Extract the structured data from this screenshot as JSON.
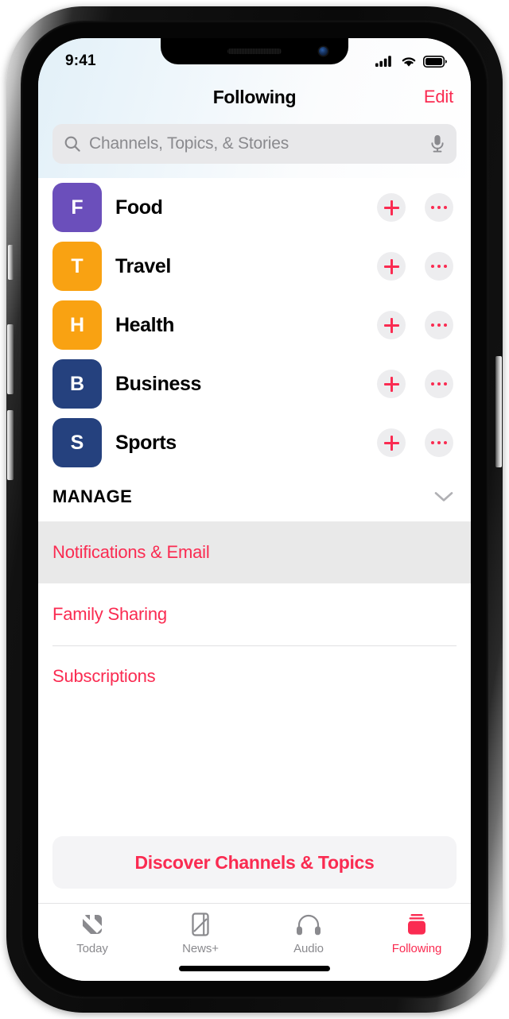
{
  "device": {
    "status_bar": {
      "time": "9:41",
      "cellular_icon": "signal-bars-icon",
      "wifi_icon": "wifi-icon",
      "battery_icon": "battery-full-icon"
    },
    "home_indicator": "home-indicator"
  },
  "nav": {
    "title": "Following",
    "edit_label": "Edit"
  },
  "search": {
    "placeholder": "Channels, Topics, & Stories",
    "value": "",
    "search_icon": "search-icon",
    "mic_icon": "microphone-icon"
  },
  "channels": [
    {
      "letter": "F",
      "name": "Food",
      "color": "#6B4FBB",
      "add_icon": "plus-icon",
      "more_icon": "ellipsis-icon"
    },
    {
      "letter": "T",
      "name": "Travel",
      "color": "#F9A212",
      "add_icon": "plus-icon",
      "more_icon": "ellipsis-icon"
    },
    {
      "letter": "H",
      "name": "Health",
      "color": "#F9A212",
      "add_icon": "plus-icon",
      "more_icon": "ellipsis-icon"
    },
    {
      "letter": "B",
      "name": "Business",
      "color": "#25417E",
      "add_icon": "plus-icon",
      "more_icon": "ellipsis-icon"
    },
    {
      "letter": "S",
      "name": "Sports",
      "color": "#25417E",
      "add_icon": "plus-icon",
      "more_icon": "ellipsis-icon"
    }
  ],
  "manage": {
    "header": "MANAGE",
    "collapse_icon": "chevron-down-icon",
    "items": [
      {
        "label": "Notifications & Email",
        "highlighted": true,
        "divider_above": false
      },
      {
        "label": "Family Sharing",
        "highlighted": false,
        "divider_above": false
      },
      {
        "label": "Subscriptions",
        "highlighted": false,
        "divider_above": true
      }
    ]
  },
  "discover": {
    "label": "Discover Channels & Topics"
  },
  "tabs": [
    {
      "label": "Today",
      "icon": "apple-news-n-icon",
      "active": false
    },
    {
      "label": "News+",
      "icon": "magazine-icon",
      "active": false
    },
    {
      "label": "Audio",
      "icon": "headphones-icon",
      "active": false
    },
    {
      "label": "Following",
      "icon": "card-stack-icon",
      "active": true
    }
  ],
  "colors": {
    "accent_red": "#fa2b51",
    "inactive_grey": "#8a8a8e",
    "tile_purple": "#6B4FBB",
    "tile_orange": "#F9A212",
    "tile_navy": "#25417E",
    "highlight_row": "#e9e9e9"
  }
}
